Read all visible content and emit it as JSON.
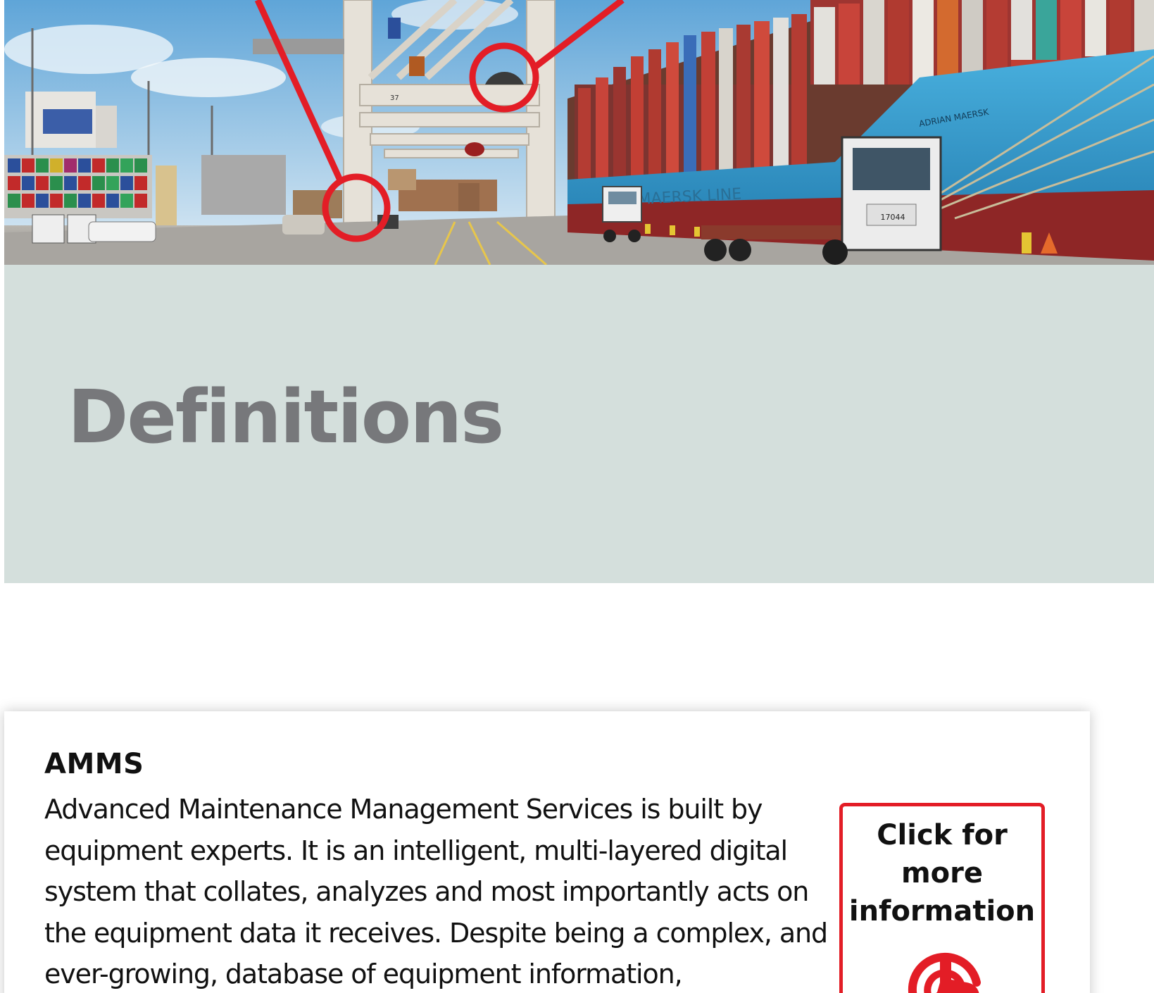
{
  "hero": {
    "description_icon": "port-crane-photo",
    "crane_number": "37",
    "ship_name": "ADRIAN MAERSK",
    "hull_text": "MAERSK LINE",
    "truck_number": "17044"
  },
  "section": {
    "title": "Definitions"
  },
  "definition": {
    "term": "AMMS",
    "text": "Advanced Maintenance Management Services is built by equipment experts. It is an intelligent, multi-layered digital system that collates, analyzes and most importantly acts on the equipment data it receives. Despite being a complex, and ever-growing, database of equipment information,",
    "button_label": "Click for\nmore\ninformation",
    "button_icon": "tap-hand-icon"
  },
  "colors": {
    "accent_red": "#e31d26",
    "band_bg": "#d4dfdc",
    "title_gray": "#77787b",
    "hull_blue": "#3a9fd0"
  }
}
